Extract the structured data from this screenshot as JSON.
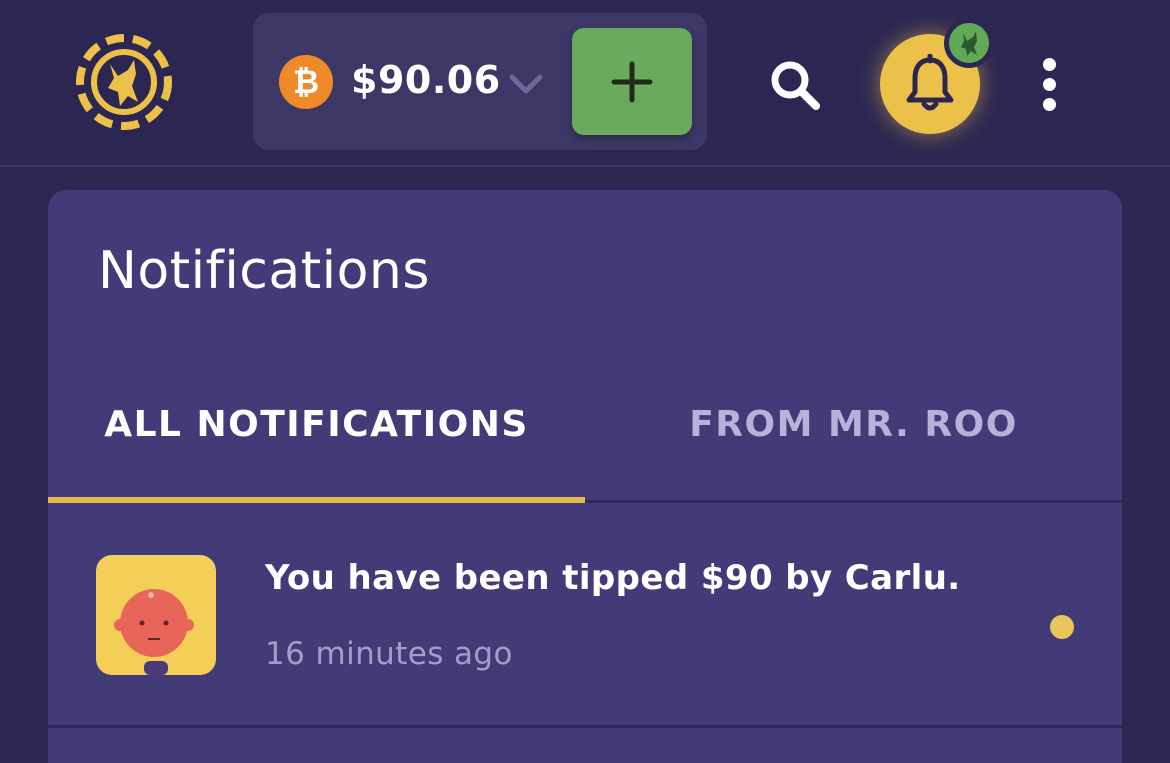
{
  "header": {
    "logo_icon": "kangaroo-chip-logo-icon",
    "wallet": {
      "currency_icon": "bitcoin-icon",
      "balance": "$90.06",
      "dropdown_icon": "chevron-down-icon",
      "add_icon": "plus-icon"
    },
    "search_icon": "search-icon",
    "notifications_icon": "bell-icon",
    "menu_icon": "more-vertical-icon"
  },
  "panel": {
    "title": "Notifications",
    "tabs": [
      {
        "label": "ALL NOTIFICATIONS",
        "active": true
      },
      {
        "label": "FROM MR. ROO",
        "active": false
      }
    ],
    "notifications": [
      {
        "message": "You have been tipped $90 by Carlu.",
        "time": "16 minutes ago",
        "unread": true
      }
    ]
  },
  "colors": {
    "background": "#2c2752",
    "panel": "#433b78",
    "accent_gold": "#ecc14a",
    "add_green": "#6aaa5d",
    "bitcoin_orange": "#f0892a"
  }
}
